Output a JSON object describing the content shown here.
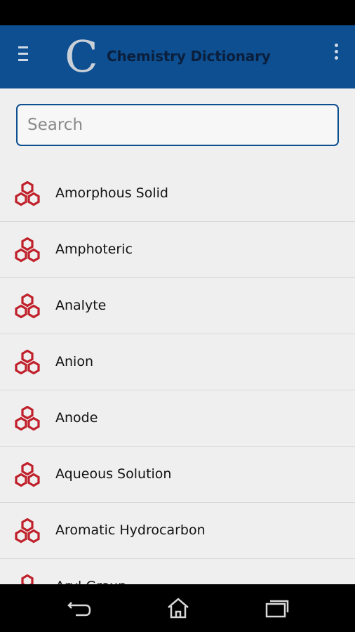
{
  "app_bar": {
    "logo_letter": "C",
    "title": "Chemistry Dictionary",
    "menu_icon": "hamburger-menu-icon",
    "overflow_icon": "more-vertical-icon",
    "background_color": "#0d4f91"
  },
  "search": {
    "placeholder": "Search",
    "value": ""
  },
  "list": {
    "item_icon": "benzene-ring-icon",
    "icon_color": "#c0202a",
    "items": [
      {
        "label": "Amorphous Solid"
      },
      {
        "label": "Amphoteric"
      },
      {
        "label": "Analyte"
      },
      {
        "label": "Anion"
      },
      {
        "label": "Anode"
      },
      {
        "label": "Aqueous Solution"
      },
      {
        "label": "Aromatic Hydrocarbon"
      },
      {
        "label": "Aryl Group"
      }
    ]
  },
  "nav_bar": {
    "back_icon": "back-icon",
    "home_icon": "home-icon",
    "recent_icon": "recent-apps-icon"
  }
}
